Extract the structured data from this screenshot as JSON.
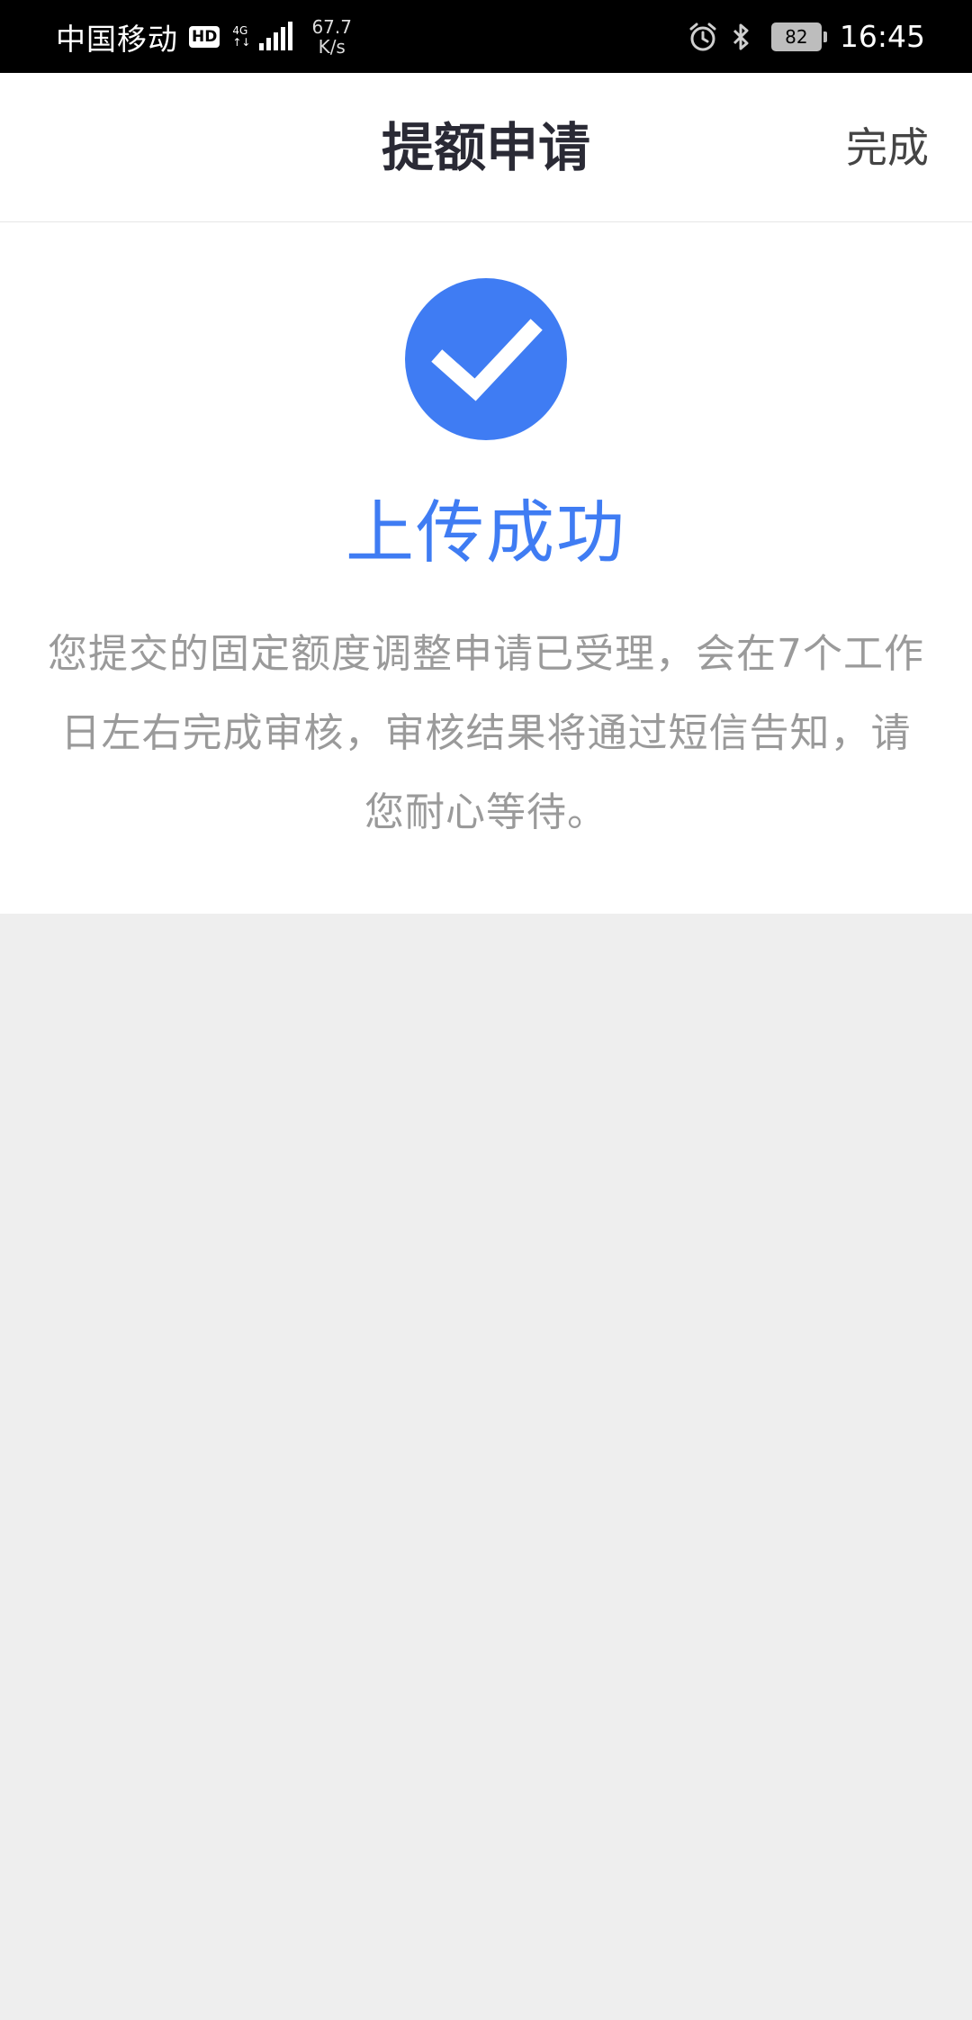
{
  "status_bar": {
    "carrier": "中国移动",
    "hd": "HD",
    "network_top": "4G",
    "network_bottom": "↑↓",
    "speed_value": "67.7",
    "speed_unit": "K/s",
    "battery": "82",
    "time": "16:45"
  },
  "nav": {
    "title": "提额申请",
    "done_label": "完成"
  },
  "result": {
    "icon": "checkmark-icon",
    "title": "上传成功",
    "description": "您提交的固定额度调整申请已受理，会在7个工作日左右完成审核，审核结果将通过短信告知，请您耐心等待。"
  },
  "colors": {
    "accent": "#3f7cf3",
    "background": "#eeeeee",
    "text_gray": "#9a9a9a"
  }
}
